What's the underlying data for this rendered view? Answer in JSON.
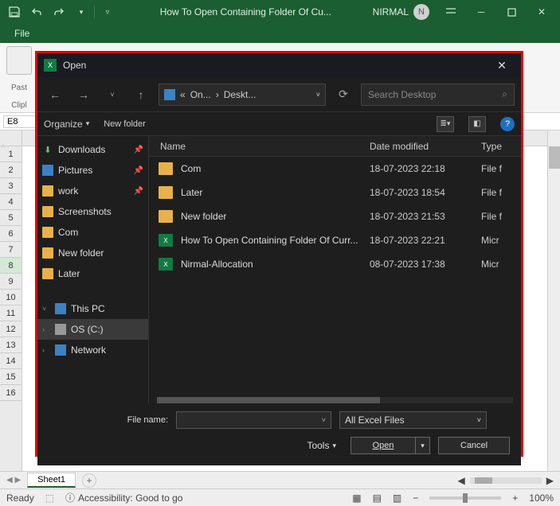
{
  "titlebar": {
    "doc_title": "How To Open Containing Folder Of Cu...",
    "user": "NIRMAL",
    "user_initial": "N"
  },
  "ribbon": {
    "file_tab": "File",
    "paste": "Past",
    "clipboard_group": "Clipl"
  },
  "name_box": "E8",
  "rows": [
    "1",
    "2",
    "3",
    "4",
    "5",
    "6",
    "7",
    "8",
    "9",
    "10",
    "11",
    "12",
    "13",
    "14",
    "15",
    "16"
  ],
  "sheet_tabs": {
    "active": "Sheet1"
  },
  "hscroll": {
    "nav": "◀  ▶"
  },
  "status": {
    "ready": "Ready",
    "accessibility": "Accessibility: Good to go",
    "zoom": "100%"
  },
  "dialog": {
    "title": "Open",
    "breadcrumb": {
      "seg1": "On...",
      "seg2": "Deskt..."
    },
    "search_placeholder": "Search Desktop",
    "toolbar": {
      "organize": "Organize",
      "new_folder": "New folder"
    },
    "columns": {
      "name": "Name",
      "date": "Date modified",
      "type": "Type"
    },
    "tree": [
      {
        "icon": "download",
        "label": "Downloads",
        "pinned": true
      },
      {
        "icon": "pictures",
        "label": "Pictures",
        "pinned": true
      },
      {
        "icon": "folder",
        "label": "work",
        "pinned": true
      },
      {
        "icon": "folder",
        "label": "Screenshots"
      },
      {
        "icon": "folder",
        "label": "Com"
      },
      {
        "icon": "folder",
        "label": "New folder"
      },
      {
        "icon": "folder",
        "label": "Later"
      }
    ],
    "tree2": {
      "thispc": "This PC",
      "drive": "OS (C:)",
      "network": "Network"
    },
    "files": [
      {
        "icon": "folder",
        "name": "Com",
        "date": "18-07-2023 22:18",
        "type": "File f"
      },
      {
        "icon": "folder",
        "name": "Later",
        "date": "18-07-2023 18:54",
        "type": "File f"
      },
      {
        "icon": "folder",
        "name": "New folder",
        "date": "18-07-2023 21:53",
        "type": "File f"
      },
      {
        "icon": "excel",
        "name": "How To Open Containing Folder Of Curr...",
        "date": "18-07-2023 22:21",
        "type": "Micr"
      },
      {
        "icon": "excel",
        "name": "Nirmal-Allocation",
        "date": "08-07-2023 17:38",
        "type": "Micr"
      }
    ],
    "footer": {
      "filename_label": "File name:",
      "filetype": "All Excel Files",
      "tools": "Tools",
      "open": "Open",
      "cancel": "Cancel"
    }
  }
}
